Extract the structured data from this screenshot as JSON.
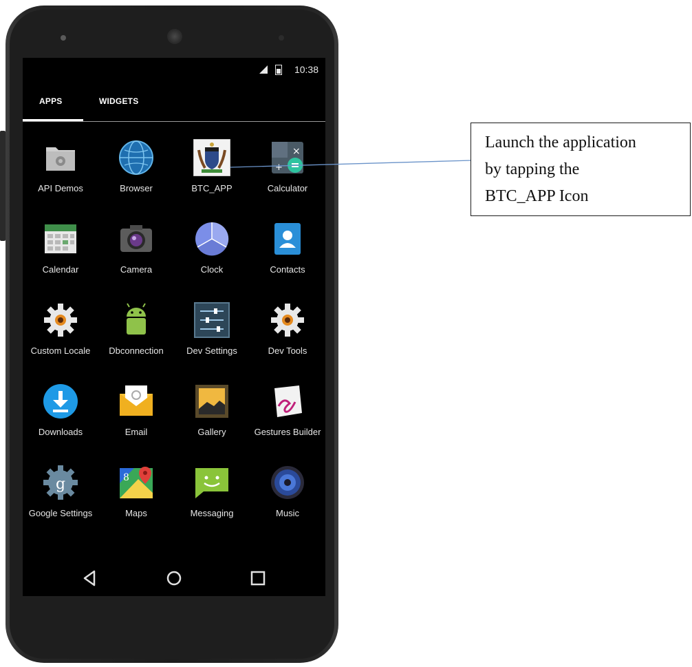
{
  "status_bar": {
    "time": "10:38"
  },
  "tabs": [
    {
      "label": "APPS",
      "active": true
    },
    {
      "label": "WIDGETS",
      "active": false
    }
  ],
  "apps": [
    {
      "label": "API Demos",
      "icon": "folder-gear-icon"
    },
    {
      "label": "Browser",
      "icon": "globe-icon"
    },
    {
      "label": "BTC_APP",
      "icon": "coat-of-arms-icon"
    },
    {
      "label": "Calculator",
      "icon": "calculator-icon"
    },
    {
      "label": "Calendar",
      "icon": "calendar-icon"
    },
    {
      "label": "Camera",
      "icon": "camera-icon"
    },
    {
      "label": "Clock",
      "icon": "clock-icon"
    },
    {
      "label": "Contacts",
      "icon": "contacts-icon"
    },
    {
      "label": "Custom Locale",
      "icon": "gear-icon"
    },
    {
      "label": "Dbconnection",
      "icon": "android-icon"
    },
    {
      "label": "Dev Settings",
      "icon": "sliders-icon"
    },
    {
      "label": "Dev Tools",
      "icon": "gear-icon"
    },
    {
      "label": "Downloads",
      "icon": "download-icon"
    },
    {
      "label": "Email",
      "icon": "envelope-icon"
    },
    {
      "label": "Gallery",
      "icon": "picture-icon"
    },
    {
      "label": "Gestures Builder",
      "icon": "gesture-icon"
    },
    {
      "label": "Google Settings",
      "icon": "google-gear-icon"
    },
    {
      "label": "Maps",
      "icon": "map-icon"
    },
    {
      "label": "Messaging",
      "icon": "message-icon"
    },
    {
      "label": "Music",
      "icon": "speaker-icon"
    }
  ],
  "nav": {
    "back": "back-icon",
    "home": "home-icon",
    "recents": "recents-icon"
  },
  "callout": {
    "lines": [
      "Launch the application",
      "by tapping the",
      "BTC_APP Icon"
    ],
    "line_color": "#6a93c9"
  },
  "colors": {
    "screen_bg": "#000000",
    "label": "#e6e6e6",
    "accent_green": "#2ec4a0"
  }
}
